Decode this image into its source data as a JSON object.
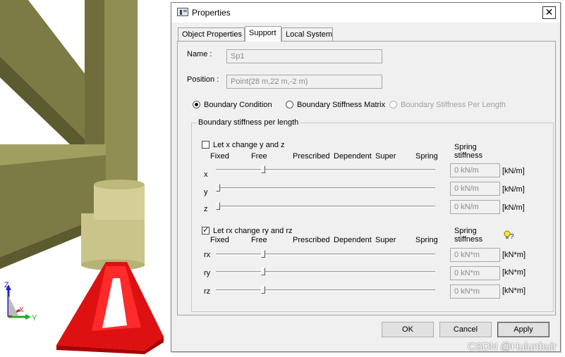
{
  "window": {
    "title": "Properties",
    "close_glyph": "✕"
  },
  "tabs": [
    {
      "label": "Object Properties",
      "active": false
    },
    {
      "label": "Support",
      "active": true
    },
    {
      "label": "Local System",
      "active": false
    }
  ],
  "support": {
    "name_label": "Name :",
    "name_value": "Sp1",
    "position_label": "Position :",
    "position_value": "Point(28 m,22 m,-2 m)",
    "modes": [
      {
        "label": "Boundary Condition",
        "selected": true,
        "enabled": true
      },
      {
        "label": "Boundary Stiffness Matrix",
        "selected": false,
        "enabled": true
      },
      {
        "label": "Boundary Stiffness Per Length",
        "selected": false,
        "enabled": false
      }
    ],
    "group_title": "Boundary stiffness per length",
    "translation": {
      "check_label": "Let x change y and z",
      "checked": false,
      "scale_labels": [
        "Fixed",
        "Free",
        "Prescribed",
        "Dependent",
        "Super",
        "Spring"
      ],
      "spring_header": "Spring stiffness",
      "spring_header_line1": "Spring",
      "spring_header_line2": "stiffness",
      "rows": [
        {
          "axis": "x",
          "level": 0.21,
          "value": "0 kN/m",
          "unit": "[kN/m]"
        },
        {
          "axis": "y",
          "level": 0.0,
          "value": "0 kN/m",
          "unit": "[kN/m]"
        },
        {
          "axis": "z",
          "level": 0.0,
          "value": "0 kN/m",
          "unit": "[kN/m]"
        }
      ]
    },
    "rotation": {
      "check_label": "Let rx change ry and rz",
      "checked": true,
      "scale_labels": [
        "Fixed",
        "Free",
        "Prescribed",
        "Dependent",
        "Super",
        "Spring"
      ],
      "spring_header_line1": "Spring",
      "spring_header_line2": "stiffness",
      "hint_icon": "lightbulb-question-icon",
      "rows": [
        {
          "axis": "rx",
          "level": 0.21,
          "value": "0 kN*m",
          "unit": "[kN*m]"
        },
        {
          "axis": "ry",
          "level": 0.21,
          "value": "0 kN*m",
          "unit": "[kN*m]"
        },
        {
          "axis": "rz",
          "level": 0.21,
          "value": "0 kN*m",
          "unit": "[kN*m]"
        }
      ]
    }
  },
  "buttons": {
    "ok": "OK",
    "cancel": "Cancel",
    "apply": "Apply"
  },
  "viewport": {
    "axes": {
      "z": "Z",
      "x": "X",
      "y": "Y"
    },
    "member_color": "#7d7b45",
    "support_color": "#dd1111"
  },
  "watermark": "CSDN @Hulunbuir"
}
